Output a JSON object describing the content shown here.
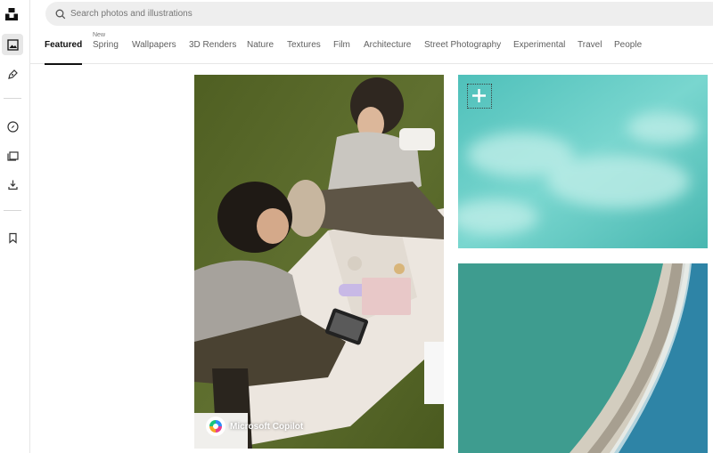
{
  "search": {
    "placeholder": "Search photos and illustrations"
  },
  "rail": {
    "items": [
      {
        "icon": "photo-icon",
        "active": true
      },
      {
        "icon": "pen-icon",
        "active": false
      },
      {
        "icon": "compass-icon",
        "active": false
      },
      {
        "icon": "collections-icon",
        "active": false
      },
      {
        "icon": "download-icon",
        "active": false
      },
      {
        "icon": "bookmark-icon",
        "active": false
      }
    ]
  },
  "tabs": [
    {
      "label": "Featured",
      "active": true,
      "badge": ""
    },
    {
      "label": "Spring",
      "active": false,
      "badge": "New"
    },
    {
      "label": "Wallpapers",
      "active": false,
      "badge": ""
    },
    {
      "label": "3D Renders",
      "active": false,
      "badge": ""
    },
    {
      "label": "Nature",
      "active": false,
      "badge": ""
    },
    {
      "label": "Textures",
      "active": false,
      "badge": ""
    },
    {
      "label": "Film",
      "active": false,
      "badge": ""
    },
    {
      "label": "Architecture",
      "active": false,
      "badge": ""
    },
    {
      "label": "Street Photography",
      "active": false,
      "badge": ""
    },
    {
      "label": "Experimental",
      "active": false,
      "badge": ""
    },
    {
      "label": "Travel",
      "active": false,
      "badge": ""
    },
    {
      "label": "People",
      "active": false,
      "badge": ""
    }
  ],
  "photos": {
    "sponsored": {
      "sponsor_name": "Microsoft Copilot",
      "description": "two people picnicking on grass"
    },
    "teal_texture": {
      "description": "aerial turquoise water"
    },
    "breakwater": {
      "description": "aerial breakwater and sea"
    }
  },
  "colors": {
    "grass": "#5a6a2a",
    "teal": "#5cc7c0",
    "sea": "#3e9c8f"
  }
}
